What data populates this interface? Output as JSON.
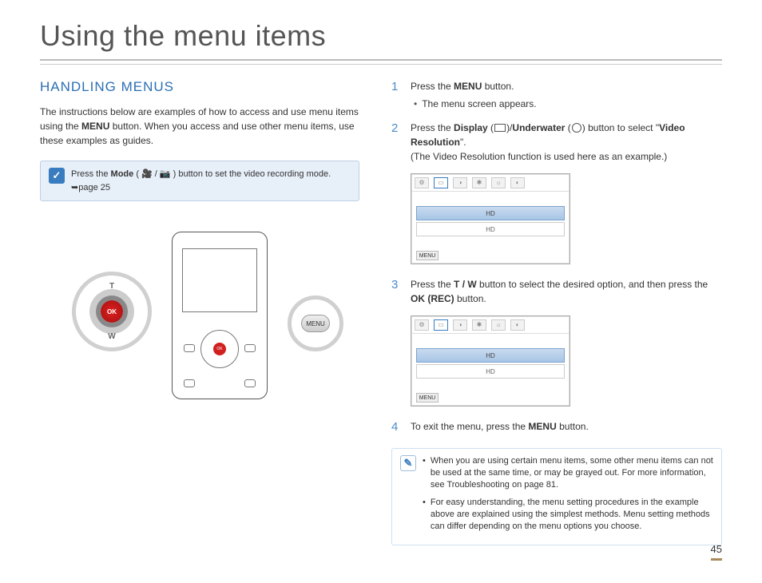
{
  "title": "Using the menu items",
  "section": "HANDLING MENUS",
  "intro_a": "The instructions below are examples of how to access and use menu items using the ",
  "intro_bold": "MENU",
  "intro_b": " button. When you access and use other menu items, use these examples as guides.",
  "tip1_a": "Press the ",
  "tip1_mode": "Mode",
  "tip1_b": " ( 🎥 / 📷 ) button to set the video recording mode.",
  "tip1_page": "➥page 25",
  "device": {
    "ok": "OK",
    "T": "T",
    "W": "W",
    "menu": "MENU"
  },
  "steps": {
    "s1_a": "Press the ",
    "s1_bold": "MENU",
    "s1_b": " button.",
    "s1_bullet": "The menu screen appears.",
    "s2_a": "Press the ",
    "s2_display": "Display",
    "s2_mid": " (",
    "s2_mid2": ")/",
    "s2_under": "Underwater",
    "s2_mid3": " (",
    "s2_mid4": ") button to select \"",
    "s2_vr": "Video Resolution",
    "s2_end": "\".",
    "s2_note": "(The Video Resolution function is used here as an example.)",
    "s3_a": "Press the ",
    "s3_tw": "T / W",
    "s3_b": " button to select the desired option, and then press the ",
    "s3_ok": "OK (REC)",
    "s3_c": " button.",
    "s4_a": "To exit the menu, press the ",
    "s4_menu": "MENU",
    "s4_b": " button."
  },
  "screenshot": {
    "row_label": "HD",
    "menu_label": "MENU"
  },
  "notes": {
    "n1": "When you are using certain menu items, some other menu items can not be used at the same time, or may be grayed out. For more information, see Troubleshooting on page 81.",
    "n2": "For easy understanding, the menu setting procedures in the example above are explained using the simplest methods. Menu setting methods can differ depending on the menu options you choose."
  },
  "page_number": "45"
}
